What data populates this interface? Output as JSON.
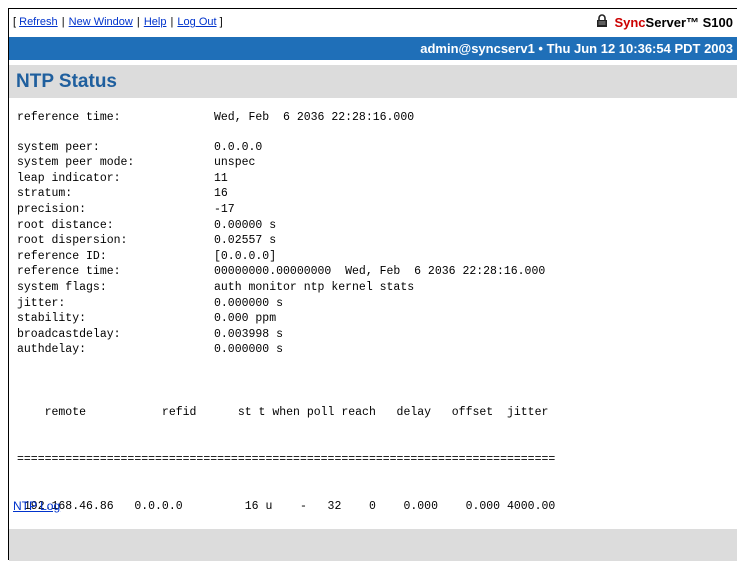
{
  "nav": {
    "open_bracket": "[",
    "close_bracket": "]",
    "sep": "|",
    "links": [
      "Refresh",
      "New Window",
      "Help",
      "Log Out"
    ]
  },
  "brand": {
    "sync": "Sync",
    "rest": "Server™ S100",
    "icon": "lock-icon"
  },
  "status": {
    "user_time": "admin@syncserv1  •  Thu Jun 12 10:36:54 PDT 2003"
  },
  "page_title": "NTP Status",
  "reference_time_top": {
    "key": "reference time:",
    "value": "Wed, Feb  6 2036 22:28:16.000"
  },
  "fields": [
    {
      "key": "system peer:",
      "value": "0.0.0.0"
    },
    {
      "key": "system peer mode:",
      "value": "unspec"
    },
    {
      "key": "leap indicator:",
      "value": "11"
    },
    {
      "key": "stratum:",
      "value": "16"
    },
    {
      "key": "precision:",
      "value": "-17"
    },
    {
      "key": "root distance:",
      "value": "0.00000 s"
    },
    {
      "key": "root dispersion:",
      "value": "0.02557 s"
    },
    {
      "key": "reference ID:",
      "value": "[0.0.0.0]"
    },
    {
      "key": "reference time:",
      "value": "00000000.00000000  Wed, Feb  6 2036 22:28:16.000"
    },
    {
      "key": "system flags:",
      "value": "auth monitor ntp kernel stats"
    },
    {
      "key": "jitter:",
      "value": "0.000000 s"
    },
    {
      "key": "stability:",
      "value": "0.000 ppm"
    },
    {
      "key": "broadcastdelay:",
      "value": "0.003998 s"
    },
    {
      "key": "authdelay:",
      "value": "0.000000 s"
    }
  ],
  "peers": {
    "header": "    remote           refid      st t when poll reach   delay   offset  jitter",
    "rule": "==============================================================================",
    "rows": [
      " 192.168.46.86   0.0.0.0         16 u    -   32    0    0.000    0.000 4000.00"
    ]
  },
  "ntp_log_link": "NTP Log",
  "colors": {
    "blue_bar": "#1f6fb8",
    "title": "#1f5f9e",
    "link": "#0033cc",
    "brand_red": "#cc0000"
  }
}
